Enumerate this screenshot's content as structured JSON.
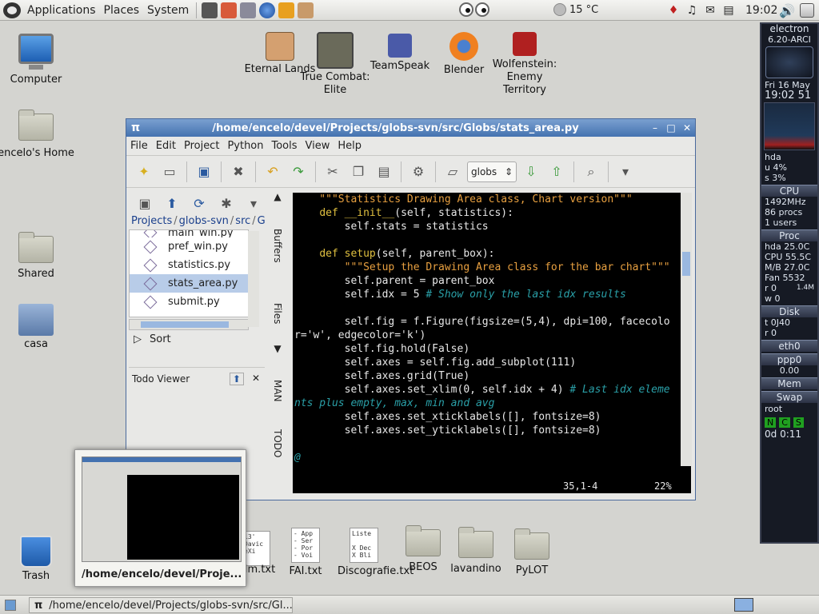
{
  "top_panel": {
    "menus": [
      "Applications",
      "Places",
      "System"
    ],
    "weather": "15 °C",
    "clock": "19:02"
  },
  "desktop_icons": {
    "computer": "Computer",
    "home": "encelo's Home",
    "shared": "Shared",
    "casa": "casa",
    "trash": "Trash",
    "eternal_lands": "Eternal Lands",
    "true_combat": "True Combat: Elite",
    "teamspeak": "TeamSpeak",
    "blender": "Blender",
    "wolfenstein": "Wolfenstein: Enemy Territory",
    "film": "Film.txt",
    "fai": "FAI.txt",
    "discografie": "Discografie.txt",
    "beos": "BEOS",
    "lavandino": "lavandino",
    "pylot": "PyLOT",
    "film_doc_text": "13'\nDavic\neXi",
    "fai_doc_text": "- App\n- Ser\n- Por\n- Voi",
    "disco_doc_text": "Liste\n\nX Dec\nX Bli"
  },
  "conky": {
    "host": "electron",
    "kernel": "6.20-ARCI",
    "date": "Fri 16 May",
    "time": "19:02 51",
    "hda": "hda",
    "user_cpu": "u 4%",
    "sys_cpu": "s 3%",
    "cpu_head": "CPU",
    "freq": "1492MHz",
    "procs": "86 procs",
    "users": "1 users",
    "proc_head": "Proc",
    "hda_temp": "hda 25.0C",
    "cpu_temp": "CPU 55.5C",
    "mb_temp": "M/B 27.0C",
    "fan": "Fan 5532",
    "read": "r 0",
    "read_rate": "1.4M",
    "write": "w 0",
    "disk_head": "Disk",
    "disk_t": "t 0J40",
    "disk_r": "r 0",
    "eth0": "eth0",
    "ppp0": "ppp0",
    "net_time": "0.00",
    "mem_head": "Mem",
    "swap_head": "Swap",
    "root": "root",
    "flags": [
      "N",
      "C",
      "S"
    ],
    "uptime": "0d 0:11"
  },
  "window": {
    "title": "/home/encelo/devel/Projects/globs-svn/src/Globs/stats_area.py",
    "menus": [
      "File",
      "Edit",
      "Project",
      "Python",
      "Tools",
      "View",
      "Help"
    ],
    "profile": "globs",
    "breadcrumb": [
      "Projects",
      "globs-svn",
      "src",
      "Globs"
    ],
    "files": [
      "main_win.py",
      "pref_win.py",
      "statistics.py",
      "stats_area.py",
      "submit.py"
    ],
    "selected_file": "stats_area.py",
    "sort_label": "Sort",
    "todo_title": "Todo Viewer",
    "side_tabs": [
      "Buffers",
      "Files",
      "MAN",
      "TODO"
    ],
    "status_position": "35,1-4",
    "status_percent": "22%"
  },
  "code_lines": [
    [
      [
        "str",
        "    \"\"\"Statistics Drawing Area class, Chart version\"\"\""
      ]
    ],
    [
      [
        "txt",
        "    "
      ],
      [
        "kw",
        "def"
      ],
      [
        "txt",
        " "
      ],
      [
        "kw",
        "__init__"
      ],
      [
        "txt",
        "(self, statistics):"
      ]
    ],
    [
      [
        "txt",
        "        self.stats = statistics"
      ]
    ],
    [
      [
        "txt",
        ""
      ]
    ],
    [
      [
        "txt",
        "    "
      ],
      [
        "kw",
        "def"
      ],
      [
        "txt",
        " "
      ],
      [
        "kw",
        "setup"
      ],
      [
        "txt",
        "(self, parent_box):"
      ]
    ],
    [
      [
        "txt",
        "        "
      ],
      [
        "str",
        "\"\"\"Setup the Drawing Area class for the bar chart\"\"\""
      ]
    ],
    [
      [
        "txt",
        "        self.parent = parent_box"
      ]
    ],
    [
      [
        "txt",
        "        self.idx = 5 "
      ],
      [
        "cm",
        "# Show only the last idx results"
      ]
    ],
    [
      [
        "txt",
        ""
      ]
    ],
    [
      [
        "txt",
        "        self.fig = f.Figure(figsize=(5,4), dpi=100, facecolo"
      ]
    ],
    [
      [
        "txt",
        "r='w', edgecolor='k')"
      ]
    ],
    [
      [
        "txt",
        "        self.fig.hold(False)"
      ]
    ],
    [
      [
        "txt",
        "        self.axes = self.fig.add_subplot(111)"
      ]
    ],
    [
      [
        "txt",
        "        self.axes.grid(True)"
      ]
    ],
    [
      [
        "txt",
        "        self.axes.set_xlim(0, self.idx + 4) "
      ],
      [
        "cm",
        "# Last idx eleme"
      ]
    ],
    [
      [
        "cm",
        "nts plus empty, max, min and avg"
      ]
    ],
    [
      [
        "txt",
        "        self.axes.set_xticklabels([], fontsize=8)"
      ]
    ],
    [
      [
        "txt",
        "        self.axes.set_yticklabels([], fontsize=8)"
      ]
    ],
    [
      [
        "txt",
        ""
      ]
    ],
    [
      [
        "cm",
        "@"
      ]
    ]
  ],
  "preview": {
    "label": "/home/encelo/devel/Proje..."
  },
  "taskbar": {
    "item": "/home/encelo/devel/Projects/globs-svn/src/Gl..."
  }
}
